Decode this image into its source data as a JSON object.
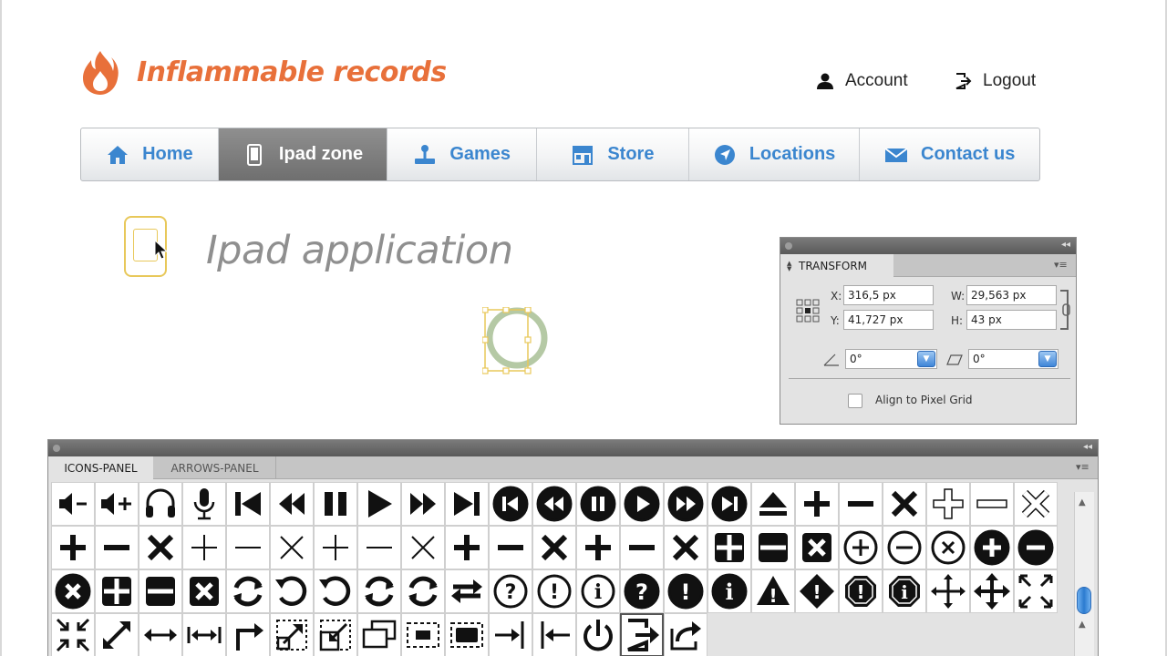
{
  "brand": {
    "name": "Inflammable records",
    "color": "#e8703a"
  },
  "top_links": {
    "account": "Account",
    "logout": "Logout"
  },
  "nav": [
    {
      "label": "Home",
      "icon": "house-icon",
      "active": false
    },
    {
      "label": "Ipad zone",
      "icon": "tablet-icon",
      "active": true
    },
    {
      "label": "Games",
      "icon": "joystick-icon",
      "active": false
    },
    {
      "label": "Store",
      "icon": "storefront-icon",
      "active": false
    },
    {
      "label": "Locations",
      "icon": "location-pin-icon",
      "active": false
    },
    {
      "label": "Contact us",
      "icon": "envelope-icon",
      "active": false
    }
  ],
  "page": {
    "heading": "Ipad application"
  },
  "transform_panel": {
    "tab": "TRANSFORM",
    "x_label": "X:",
    "x_value": "316,5 px",
    "y_label": "Y:",
    "y_value": "41,727 px",
    "w_label": "W:",
    "w_value": "29,563 px",
    "h_label": "H:",
    "h_value": "43 px",
    "rotate_value": "0°",
    "shear_value": "0°",
    "align_label": "Align to Pixel Grid"
  },
  "icons_panel": {
    "tabs": [
      "ICONS-PANEL",
      "ARROWS-PANEL"
    ],
    "active_tab": "ICONS-PANEL",
    "icons": [
      "volume-down-icon",
      "volume-up-icon",
      "headphones-icon",
      "microphone-icon",
      "skip-back-icon",
      "rewind-icon",
      "pause-icon",
      "play-icon",
      "fast-forward-icon",
      "skip-forward-icon",
      "circle-skip-back-icon",
      "circle-rewind-icon",
      "circle-pause-icon",
      "circle-play-icon",
      "circle-fast-forward-icon",
      "circle-skip-forward-icon",
      "eject-icon",
      "plus-bold-icon",
      "minus-bold-icon",
      "close-bold-icon",
      "plus-outline-icon",
      "minus-outline-icon",
      "close-outline-icon",
      "plus-heavy-icon",
      "minus-heavy-icon",
      "close-heavy-icon",
      "plus-thin-icon",
      "minus-thin-icon",
      "close-thin-icon",
      "plus-thin-2-icon",
      "minus-thin-2-icon",
      "close-thin-2-icon",
      "plus-heavy-2-icon",
      "minus-heavy-2-icon",
      "close-heavy-2-icon",
      "plus-heavy-3-icon",
      "minus-heavy-3-icon",
      "close-heavy-3-icon",
      "square-plus-icon",
      "square-minus-icon",
      "square-close-icon",
      "circle-plus-outline-icon",
      "circle-minus-outline-icon",
      "circle-close-outline-icon",
      "circle-plus-icon",
      "circle-minus-icon",
      "circle-close-icon",
      "rounded-plus-icon",
      "rounded-minus-icon",
      "rounded-close-icon",
      "refresh-icon",
      "undo-icon",
      "rotate-ccw-icon",
      "sync-icon",
      "sync-2-icon",
      "swap-icon",
      "circle-question-icon",
      "circle-exclamation-icon",
      "circle-info-icon",
      "question-filled-icon",
      "exclamation-filled-icon",
      "info-filled-icon",
      "warning-triangle-icon",
      "warning-diamond-icon",
      "octagon-exclamation-icon",
      "octagon-info-icon",
      "move-icon",
      "move-arrows-icon",
      "fullscreen-icon",
      "collapse-icon",
      "expand-diagonal-icon",
      "horizontal-arrows-icon",
      "fit-width-icon",
      "corner-arrow-icon",
      "resize-dotted-icon",
      "scale-icon",
      "duplicate-windows-icon",
      "selection-marquee-icon",
      "selection-box-icon",
      "arrow-right-bar-icon",
      "arrow-left-bar-icon",
      "power-icon",
      "exit-icon",
      "share-icon"
    ]
  }
}
